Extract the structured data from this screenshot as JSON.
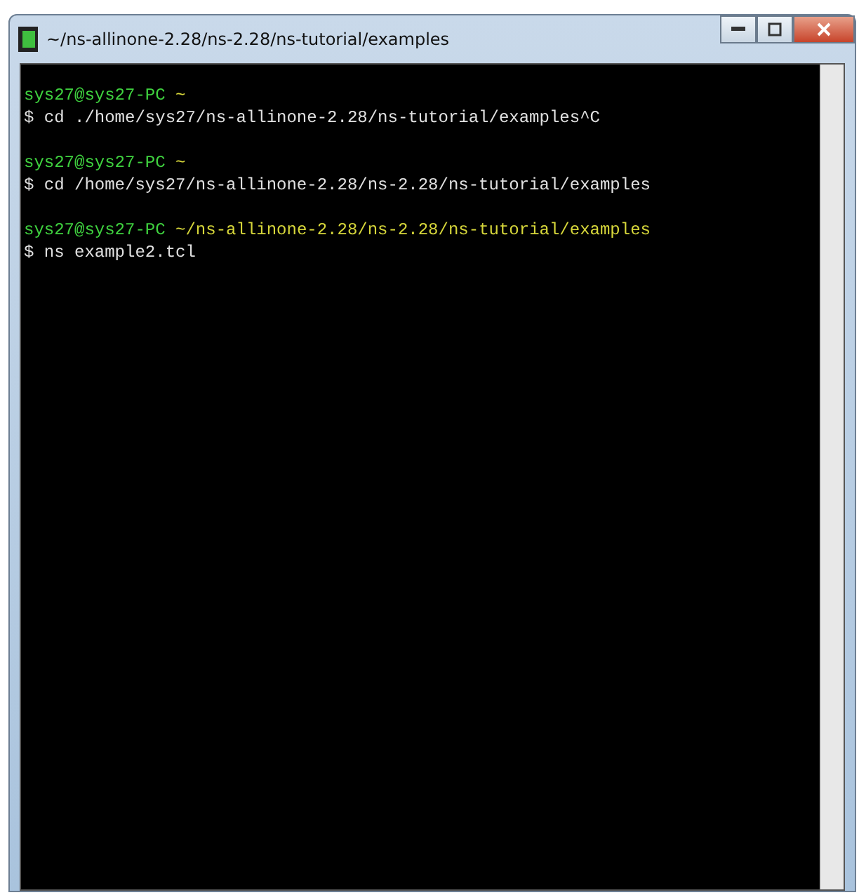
{
  "window": {
    "title": "~/ns-allinone-2.28/ns-2.28/ns-tutorial/examples"
  },
  "terminal": {
    "lines": [
      {
        "kind": "prompt",
        "user": "sys27@sys27-PC",
        "path": "~"
      },
      {
        "kind": "command",
        "text": "$ cd ./home/sys27/ns-allinone-2.28/ns-tutorial/examples^C"
      },
      {
        "kind": "blank"
      },
      {
        "kind": "prompt",
        "user": "sys27@sys27-PC",
        "path": "~"
      },
      {
        "kind": "command",
        "text": "$ cd /home/sys27/ns-allinone-2.28/ns-2.28/ns-tutorial/examples"
      },
      {
        "kind": "blank"
      },
      {
        "kind": "prompt",
        "user": "sys27@sys27-PC",
        "path": "~/ns-allinone-2.28/ns-2.28/ns-tutorial/examples"
      },
      {
        "kind": "command",
        "text": "$ ns example2.tcl"
      }
    ]
  }
}
